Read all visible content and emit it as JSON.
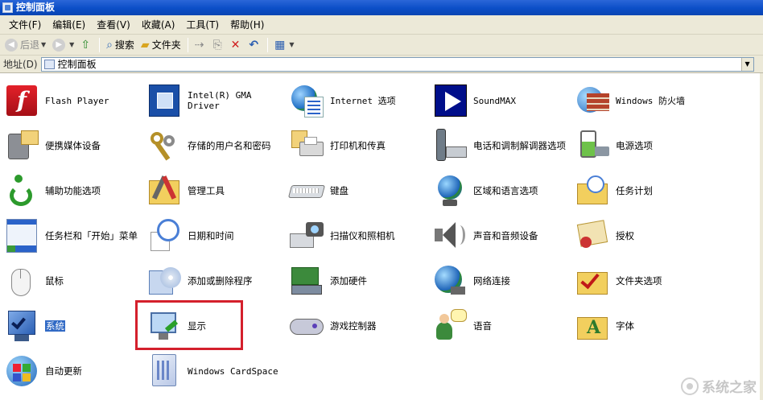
{
  "window": {
    "title": "控制面板"
  },
  "menu": [
    "文件(F)",
    "编辑(E)",
    "查看(V)",
    "收藏(A)",
    "工具(T)",
    "帮助(H)"
  ],
  "toolbar": {
    "back": "后退",
    "search": "搜索",
    "folders": "文件夹"
  },
  "address": {
    "label": "地址(D)",
    "value": "控制面板"
  },
  "items": [
    {
      "label": "Flash Player",
      "icon": "flash-player-icon",
      "mono": true
    },
    {
      "label": "Intel(R) GMA Driver",
      "icon": "intel-gma-driver-icon",
      "mono": true
    },
    {
      "label": "Internet 选项",
      "icon": "internet-options-icon",
      "mono": true
    },
    {
      "label": "SoundMAX",
      "icon": "soundmax-icon",
      "mono": true
    },
    {
      "label": "Windows 防火墙",
      "icon": "windows-firewall-icon",
      "mono": true
    },
    {
      "label": "便携媒体设备",
      "icon": "portable-media-devices-icon",
      "mono": false
    },
    {
      "label": "存储的用户名和密码",
      "icon": "stored-passwords-icon",
      "mono": false
    },
    {
      "label": "打印机和传真",
      "icon": "printers-faxes-icon",
      "mono": false
    },
    {
      "label": "电话和调制解调器选项",
      "icon": "phone-modem-icon",
      "mono": false
    },
    {
      "label": "电源选项",
      "icon": "power-options-icon",
      "mono": false
    },
    {
      "label": "辅助功能选项",
      "icon": "accessibility-icon",
      "mono": false
    },
    {
      "label": "管理工具",
      "icon": "administrative-tools-icon",
      "mono": false
    },
    {
      "label": "键盘",
      "icon": "keyboard-icon",
      "mono": false
    },
    {
      "label": "区域和语言选项",
      "icon": "regional-language-icon",
      "mono": false
    },
    {
      "label": "任务计划",
      "icon": "scheduled-tasks-icon",
      "mono": false
    },
    {
      "label": "任务栏和「开始」菜单",
      "icon": "taskbar-start-menu-icon",
      "mono": false
    },
    {
      "label": "日期和时间",
      "icon": "date-time-icon",
      "mono": false
    },
    {
      "label": "扫描仪和照相机",
      "icon": "scanners-cameras-icon",
      "mono": false
    },
    {
      "label": "声音和音频设备",
      "icon": "sounds-audio-icon",
      "mono": false
    },
    {
      "label": "授权",
      "icon": "licensing-icon",
      "mono": false
    },
    {
      "label": "鼠标",
      "icon": "mouse-icon",
      "mono": false
    },
    {
      "label": "添加或删除程序",
      "icon": "add-remove-programs-icon",
      "mono": false
    },
    {
      "label": "添加硬件",
      "icon": "add-hardware-icon",
      "mono": false
    },
    {
      "label": "网络连接",
      "icon": "network-connections-icon",
      "mono": false
    },
    {
      "label": "文件夹选项",
      "icon": "folder-options-icon",
      "mono": false
    },
    {
      "label": "系统",
      "icon": "system-icon",
      "mono": false,
      "selected": true
    },
    {
      "label": "显示",
      "icon": "display-icon",
      "mono": false
    },
    {
      "label": "游戏控制器",
      "icon": "game-controllers-icon",
      "mono": false
    },
    {
      "label": "语音",
      "icon": "speech-icon",
      "mono": false
    },
    {
      "label": "字体",
      "icon": "fonts-icon",
      "mono": false
    },
    {
      "label": "自动更新",
      "icon": "automatic-updates-icon",
      "mono": false
    },
    {
      "label": "Windows CardSpace",
      "icon": "windows-cardspace-icon",
      "mono": true
    }
  ],
  "watermark": {
    "text": "系统之家"
  }
}
